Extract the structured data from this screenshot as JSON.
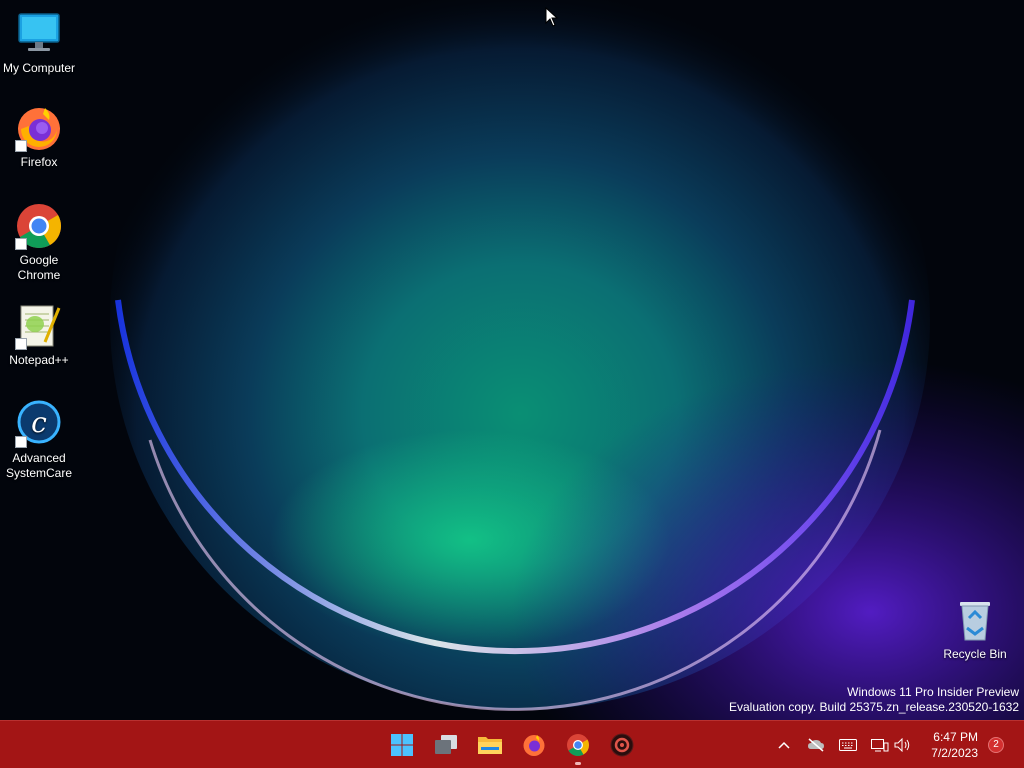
{
  "desktop": {
    "icons": [
      {
        "label": "My Computer",
        "icon": "monitor-icon"
      },
      {
        "label": "Firefox",
        "icon": "firefox-icon"
      },
      {
        "label": "Google Chrome",
        "icon": "chrome-icon"
      },
      {
        "label": "Notepad++",
        "icon": "notepadpp-icon"
      },
      {
        "label": "Advanced SystemCare",
        "icon": "advanced-systemcare-icon"
      },
      {
        "label": "Recycle Bin",
        "icon": "recycle-bin-icon"
      }
    ],
    "watermark": {
      "line1": "Windows 11 Pro Insider Preview",
      "line2": "Evaluation copy. Build 25375.zn_release.230520-1632"
    }
  },
  "taskbar": {
    "background_color": "#a31515",
    "apps": [
      {
        "icon": "start-icon",
        "running": false
      },
      {
        "icon": "task-view-icon",
        "running": false
      },
      {
        "icon": "file-explorer-icon",
        "running": false
      },
      {
        "icon": "firefox-icon",
        "running": false
      },
      {
        "icon": "chrome-icon",
        "running": true
      },
      {
        "icon": "app-icon",
        "running": false
      }
    ],
    "tray": {
      "icons": [
        "chevron-up-icon",
        "cloud-off-icon",
        "keyboard-icon",
        "network-icon",
        "volume-icon"
      ],
      "time": "6:47 PM",
      "date": "7/2/2023",
      "notification_count": "2"
    }
  }
}
